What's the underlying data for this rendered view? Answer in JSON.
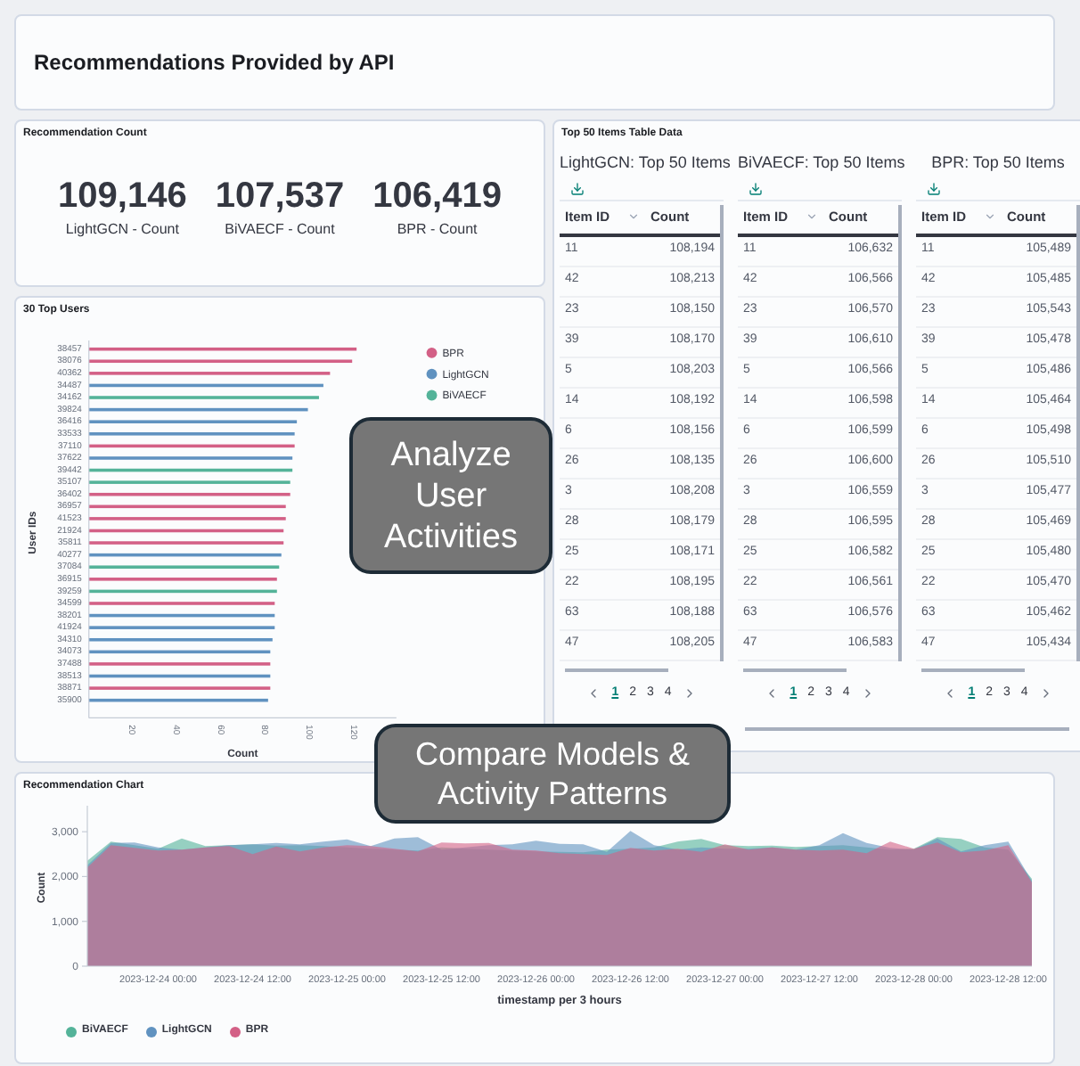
{
  "header": {
    "title": "Recommendations Provided by API"
  },
  "count_card": {
    "title": "Recommendation Count",
    "metrics": [
      {
        "value": "109,146",
        "label": "LightGCN - Count"
      },
      {
        "value": "107,537",
        "label": "BiVAECF - Count"
      },
      {
        "value": "106,419",
        "label": "BPR - Count"
      }
    ]
  },
  "top_users": {
    "chart_data": {
      "type": "bar",
      "orientation": "horizontal",
      "legend": "right",
      "title": "30 Top Users",
      "xlabel": "Count",
      "ylabel": "User IDs",
      "xlim": [
        0,
        139
      ],
      "xticks": [
        20,
        40,
        60,
        80,
        100,
        120
      ],
      "categories": [
        "38457",
        "38076",
        "40362",
        "34487",
        "34162",
        "39824",
        "36416",
        "33533",
        "37110",
        "37622",
        "39442",
        "35107",
        "36402",
        "36957",
        "41523",
        "21924",
        "35811",
        "40277",
        "37084",
        "36915",
        "39259",
        "34599",
        "38201",
        "41924",
        "34310",
        "34073",
        "37488",
        "38513",
        "38871",
        "35900"
      ],
      "series": [
        {
          "name": "BPR",
          "color": "#d36086",
          "values": [
            121,
            119,
            109,
            null,
            null,
            null,
            null,
            null,
            93,
            null,
            null,
            null,
            91,
            89,
            89,
            88,
            88,
            null,
            null,
            85,
            null,
            84,
            null,
            null,
            null,
            null,
            82,
            null,
            82,
            null
          ]
        },
        {
          "name": "LightGCN",
          "color": "#6092c0",
          "values": [
            null,
            null,
            null,
            106,
            null,
            99,
            94,
            93,
            null,
            92,
            null,
            null,
            null,
            null,
            null,
            null,
            null,
            87,
            null,
            null,
            null,
            null,
            84,
            84,
            83,
            82,
            null,
            82,
            null,
            81
          ]
        },
        {
          "name": "BiVAECF",
          "color": "#54b399",
          "values": [
            null,
            null,
            null,
            null,
            104,
            null,
            null,
            null,
            null,
            null,
            92,
            91,
            null,
            null,
            null,
            null,
            null,
            null,
            86,
            null,
            85,
            null,
            null,
            null,
            null,
            null,
            null,
            null,
            null,
            null
          ]
        }
      ]
    }
  },
  "tables_card": {
    "title": "Top 50 Items Table Data",
    "tables": [
      {
        "title": "LightGCN: Top 50 Items",
        "columns": [
          "Item ID",
          "Count"
        ],
        "rows": [
          [
            "11",
            "108,194"
          ],
          [
            "42",
            "108,213"
          ],
          [
            "23",
            "108,150"
          ],
          [
            "39",
            "108,170"
          ],
          [
            "5",
            "108,203"
          ],
          [
            "14",
            "108,192"
          ],
          [
            "6",
            "108,156"
          ],
          [
            "26",
            "108,135"
          ],
          [
            "3",
            "108,208"
          ],
          [
            "28",
            "108,179"
          ],
          [
            "25",
            "108,171"
          ],
          [
            "22",
            "108,195"
          ],
          [
            "63",
            "108,188"
          ],
          [
            "47",
            "108,205"
          ]
        ],
        "pages": [
          {
            "label": "1",
            "selected": true
          },
          {
            "label": "2",
            "selected": false
          },
          {
            "label": "3",
            "selected": false
          },
          {
            "label": "4",
            "selected": false
          }
        ]
      },
      {
        "title": "BiVAECF: Top 50 Items",
        "columns": [
          "Item ID",
          "Count"
        ],
        "rows": [
          [
            "11",
            "106,632"
          ],
          [
            "42",
            "106,566"
          ],
          [
            "23",
            "106,570"
          ],
          [
            "39",
            "106,610"
          ],
          [
            "5",
            "106,566"
          ],
          [
            "14",
            "106,598"
          ],
          [
            "6",
            "106,599"
          ],
          [
            "26",
            "106,600"
          ],
          [
            "3",
            "106,559"
          ],
          [
            "28",
            "106,595"
          ],
          [
            "25",
            "106,582"
          ],
          [
            "22",
            "106,561"
          ],
          [
            "63",
            "106,576"
          ],
          [
            "47",
            "106,583"
          ]
        ],
        "pages": [
          {
            "label": "1",
            "selected": true
          },
          {
            "label": "2",
            "selected": false
          },
          {
            "label": "3",
            "selected": false
          },
          {
            "label": "4",
            "selected": false
          }
        ]
      },
      {
        "title": "BPR: Top 50 Items",
        "columns": [
          "Item ID",
          "Count"
        ],
        "rows": [
          [
            "11",
            "105,489"
          ],
          [
            "42",
            "105,485"
          ],
          [
            "23",
            "105,543"
          ],
          [
            "39",
            "105,478"
          ],
          [
            "5",
            "105,486"
          ],
          [
            "14",
            "105,464"
          ],
          [
            "6",
            "105,498"
          ],
          [
            "26",
            "105,510"
          ],
          [
            "3",
            "105,477"
          ],
          [
            "28",
            "105,469"
          ],
          [
            "25",
            "105,480"
          ],
          [
            "22",
            "105,470"
          ],
          [
            "63",
            "105,462"
          ],
          [
            "47",
            "105,434"
          ]
        ],
        "pages": [
          {
            "label": "1",
            "selected": true
          },
          {
            "label": "2",
            "selected": false
          },
          {
            "label": "3",
            "selected": false
          },
          {
            "label": "4",
            "selected": false
          }
        ]
      }
    ]
  },
  "recommendation_chart": {
    "chart_data": {
      "type": "area",
      "legend": "bottom",
      "title": "Recommendation Chart",
      "xlabel": "timestamp per 3 hours",
      "ylabel": "Count",
      "ylim": [
        0,
        3500
      ],
      "yticks": [
        {
          "value": 0,
          "label": "0"
        },
        {
          "value": 1000,
          "label": "1,000"
        },
        {
          "value": 2000,
          "label": "2,000"
        },
        {
          "value": 3000,
          "label": "3,000"
        }
      ],
      "categories": [
        null,
        null,
        null,
        "2023-12-24 00:00",
        null,
        null,
        null,
        "2023-12-24 12:00",
        null,
        null,
        null,
        "2023-12-25 00:00",
        null,
        null,
        null,
        "2023-12-25 12:00",
        null,
        null,
        null,
        "2023-12-26 00:00",
        null,
        null,
        null,
        "2023-12-26 12:00",
        null,
        null,
        null,
        "2023-12-27 00:00",
        null,
        null,
        null,
        "2023-12-27 12:00",
        null,
        null,
        null,
        "2023-12-28 00:00",
        null,
        null,
        null,
        "2023-12-28 12:00",
        null
      ],
      "series": [
        {
          "name": "BiVAECF",
          "color": "#54b399",
          "values": [
            2350,
            2780,
            2700,
            2620,
            2850,
            2680,
            2700,
            2720,
            2690,
            2700,
            2680,
            2650,
            2620,
            2600,
            2580,
            2650,
            2620,
            2600,
            2580,
            2560,
            2550,
            2540,
            2600,
            2620,
            2650,
            2780,
            2840,
            2700,
            2680,
            2690,
            2660,
            2680,
            2700,
            2650,
            2600,
            2620,
            2880,
            2840,
            2650,
            2600,
            1950
          ]
        },
        {
          "name": "LightGCN",
          "color": "#6092c0",
          "values": [
            2250,
            2750,
            2760,
            2650,
            2600,
            2650,
            2700,
            2720,
            2750,
            2720,
            2780,
            2830,
            2680,
            2850,
            2880,
            2600,
            2650,
            2700,
            2720,
            2800,
            2730,
            2720,
            2550,
            3020,
            2700,
            2600,
            2650,
            2620,
            2620,
            2650,
            2600,
            2700,
            2970,
            2750,
            2640,
            2600,
            2850,
            2560,
            2700,
            2780,
            1900
          ]
        },
        {
          "name": "BPR",
          "color": "#d36086",
          "values": [
            2200,
            2700,
            2640,
            2580,
            2600,
            2650,
            2680,
            2500,
            2670,
            2560,
            2650,
            2700,
            2680,
            2620,
            2560,
            2760,
            2740,
            2750,
            2600,
            2580,
            2520,
            2500,
            2480,
            2640,
            2580,
            2620,
            2550,
            2720,
            2600,
            2650,
            2600,
            2580,
            2600,
            2520,
            2780,
            2620,
            2760,
            2540,
            2580,
            2700,
            1870
          ]
        }
      ]
    }
  },
  "callouts": [
    "Analyze User Activities",
    "Compare Models & Activity Patterns"
  ]
}
